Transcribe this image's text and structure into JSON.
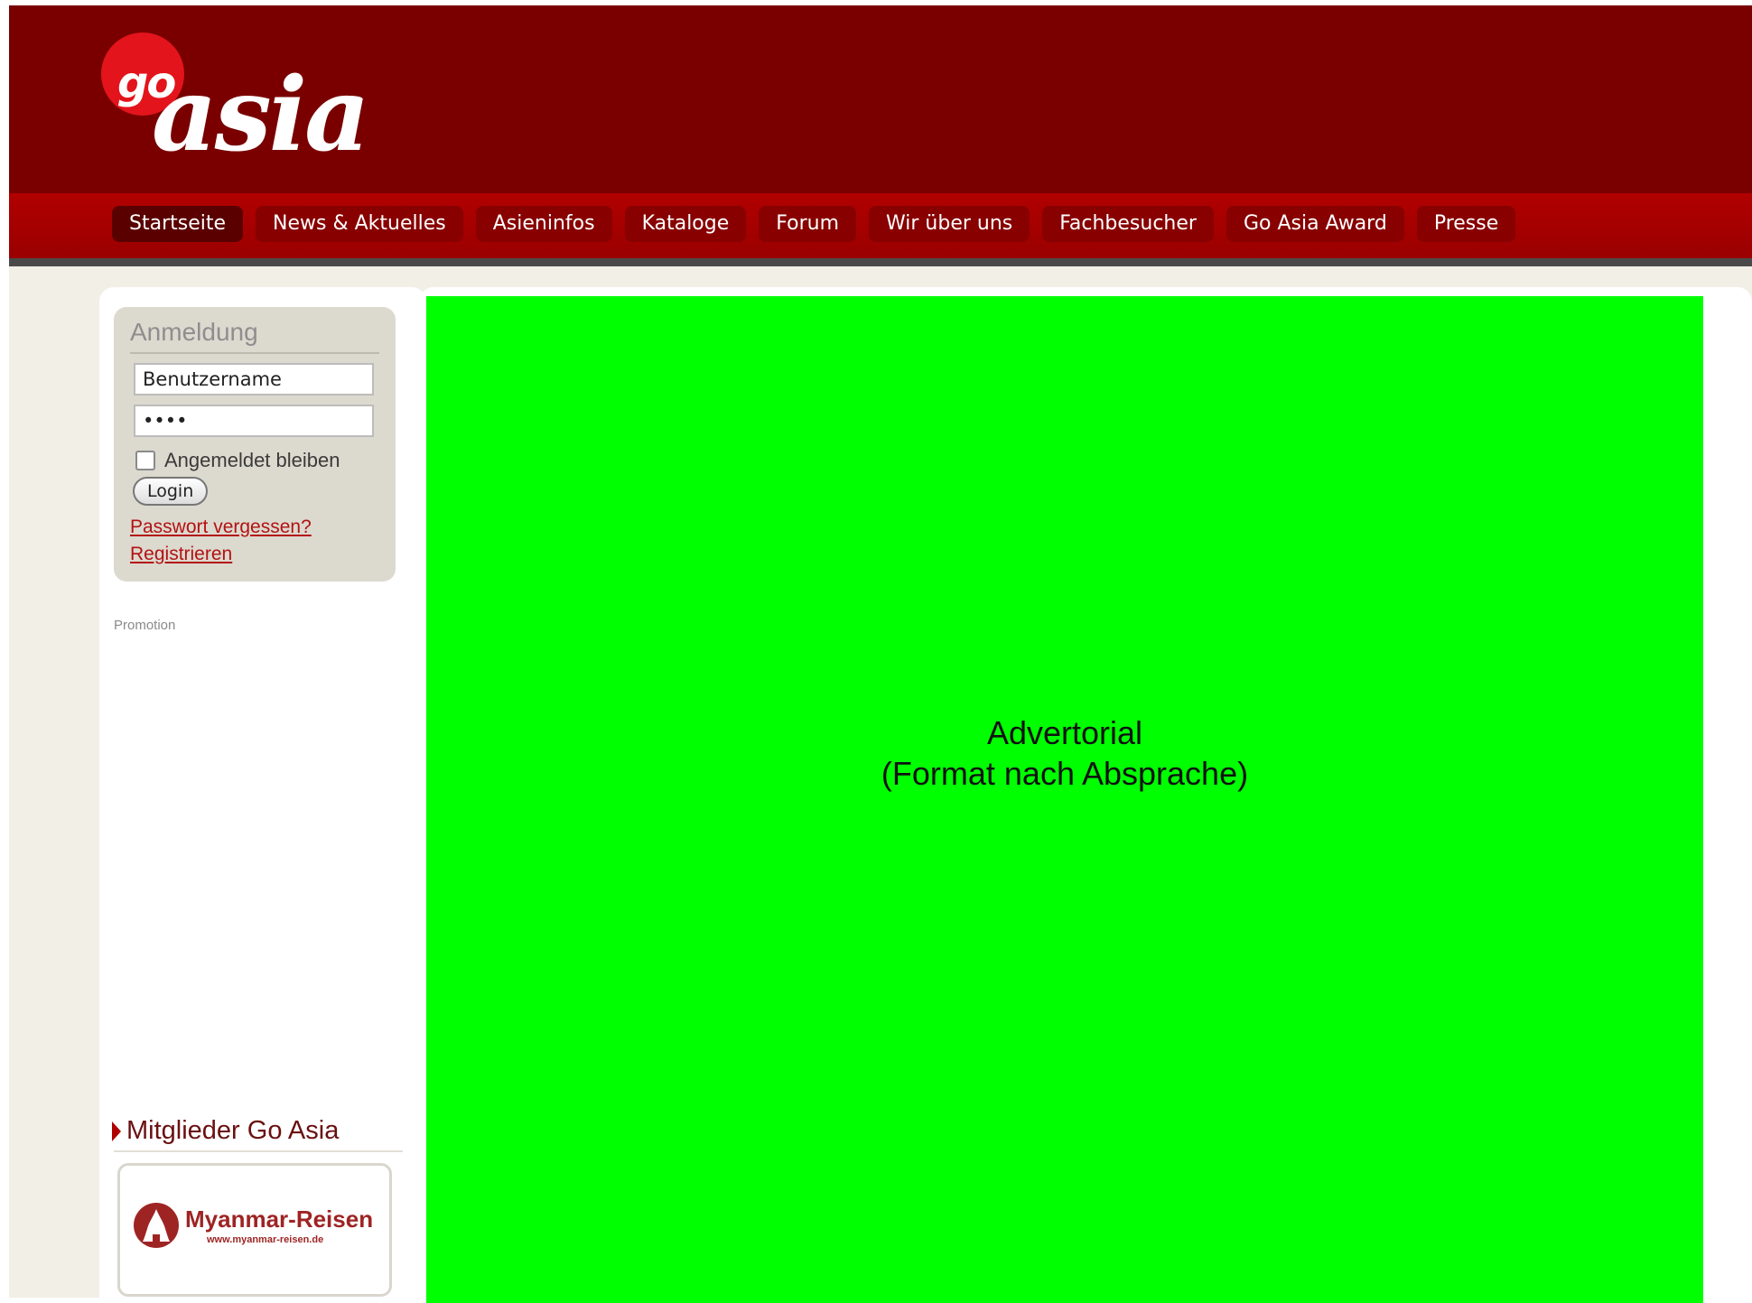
{
  "logo": {
    "go": "go",
    "asia": "asia"
  },
  "nav": [
    {
      "label": "Startseite",
      "active": true
    },
    {
      "label": "News & Aktuelles"
    },
    {
      "label": "Asieninfos"
    },
    {
      "label": "Kataloge"
    },
    {
      "label": "Forum"
    },
    {
      "label": "Wir über uns"
    },
    {
      "label": "Fachbesucher"
    },
    {
      "label": "Go Asia Award"
    },
    {
      "label": "Presse"
    }
  ],
  "login": {
    "title": "Anmeldung",
    "username_value": "Benutzername",
    "password_value": "••••",
    "remember_label": "Angemeldet bleiben",
    "remember_checked": false,
    "button_label": "Login",
    "forgot_link": "Passwort vergessen?",
    "register_link": "Registrieren"
  },
  "promotion_label": "Promotion",
  "members": {
    "title": "Mitglieder Go Asia",
    "card_name": "Myanmar-Reisen",
    "card_url": "www.myanmar-reisen.de"
  },
  "advertorial": {
    "line1": "Advertorial",
    "line2": "(Format nach Absprache)",
    "background": "#00ff00"
  },
  "colors": {
    "header": "#7a0000",
    "navbar": "#a80000",
    "accent": "#e3141b"
  }
}
